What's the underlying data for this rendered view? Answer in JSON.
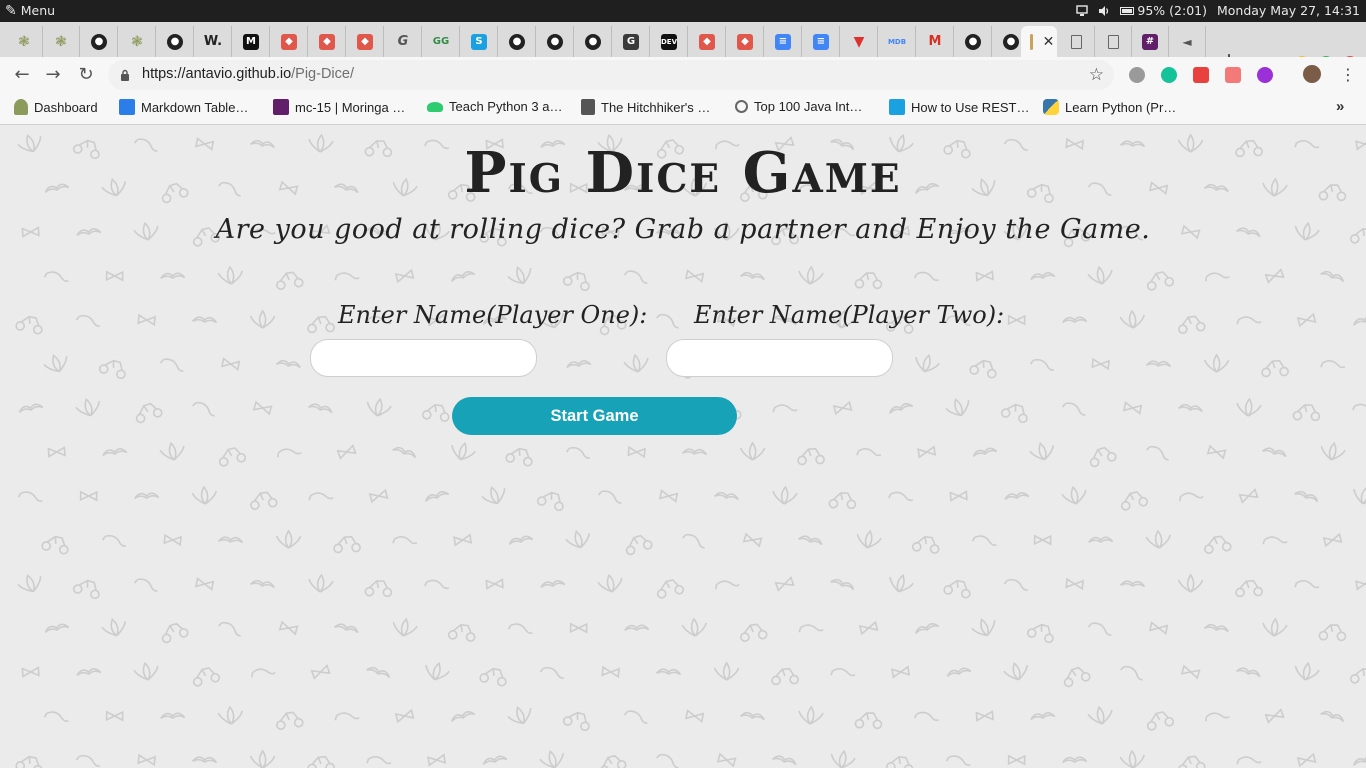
{
  "os_panel": {
    "menu_label": "Menu",
    "battery_text": "95% (2:01)",
    "datetime": "Monday May 27, 14:31"
  },
  "browser": {
    "url_host": "https://antavio.github.io",
    "url_path": "/Pig-Dice/",
    "tab_count": 27,
    "active_tab_index": 27,
    "active_tab_close": "✕",
    "new_tab_label": "+",
    "bookmarks": [
      {
        "label": "Dashboard",
        "icon": "palm-tree-icon",
        "color": "#8c9a5b"
      },
      {
        "label": "Markdown Table…",
        "icon": "table-icon",
        "color": "#2b7de9"
      },
      {
        "label": "mc-15 | Moringa …",
        "icon": "slack-icon",
        "color": "#611f69"
      },
      {
        "label": "Teach Python 3 a…",
        "icon": "turtle-icon",
        "color": "#2ecc71"
      },
      {
        "label": "The Hitchhiker's …",
        "icon": "book-icon",
        "color": "#555555"
      },
      {
        "label": "Top 100 Java Int…",
        "icon": "g-script-icon",
        "color": "#666666"
      },
      {
        "label": "How to Use REST…",
        "icon": "s-icon",
        "color": "#1ba1e2"
      },
      {
        "label": "Learn Python (Pr…",
        "icon": "python-icon",
        "color": "#3776ab"
      }
    ],
    "bookmarks_more": "»"
  },
  "page": {
    "title": "Pig Dice Game",
    "subtitle": "Are you good at rolling dice? Grab a partner and Enjoy the Game.",
    "player_one_label": "Enter Name(Player One):",
    "player_two_label": "Enter Name(Player Two):",
    "player_one_value": "",
    "player_two_value": "",
    "start_button_label": "Start Game",
    "accent_color": "#17a2b8"
  }
}
